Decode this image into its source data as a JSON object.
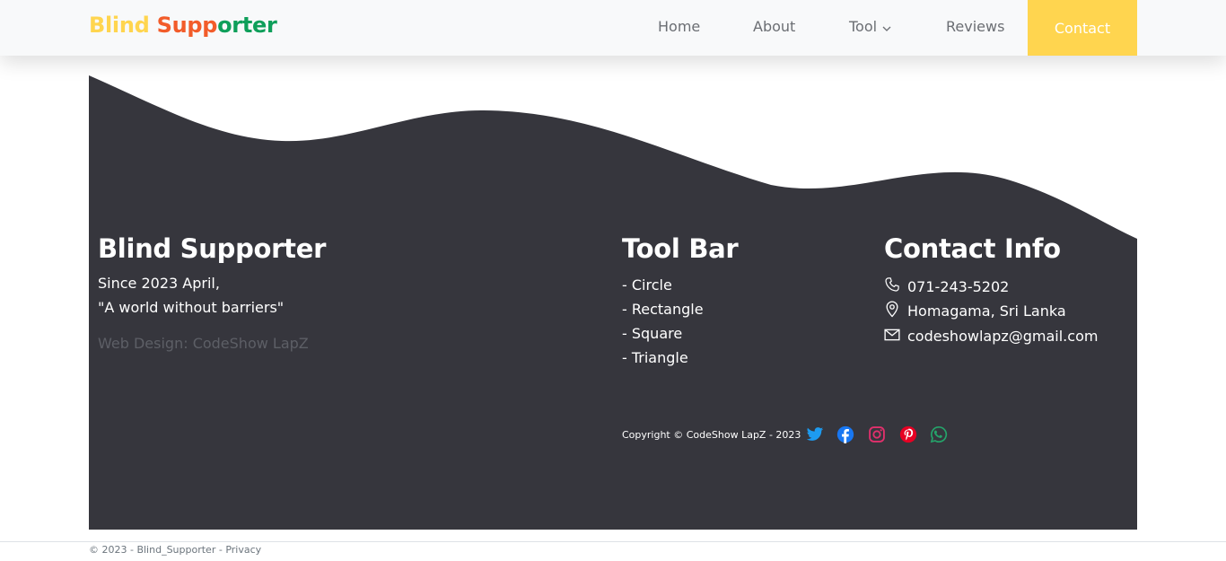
{
  "navbar": {
    "brand": {
      "part1": "Blind",
      "part2": "Supp",
      "part3": "orter"
    },
    "links": [
      {
        "label": "Home"
      },
      {
        "label": "About"
      },
      {
        "label": "Tool"
      },
      {
        "label": "Reviews"
      },
      {
        "label": "Contact"
      }
    ],
    "tool_dropdown_icon": "chevron-down-icon"
  },
  "footer": {
    "about": {
      "title": "Blind Supporter",
      "line1": "Since 2023 April,",
      "line2": "\"A world without barriers\"",
      "credit": "Web Design: CodeShow LapZ"
    },
    "toolbar": {
      "title": "Tool Bar",
      "items": [
        "- Circle",
        "- Rectangle",
        "- Square",
        "- Triangle"
      ]
    },
    "contact": {
      "title": "Contact Info",
      "phone": "071-243-5202",
      "location": "Homagama, Sri Lanka",
      "email": "codeshowlapz@gmail.com"
    },
    "copyright": "Copyright © CodeShow LapZ - 2023",
    "socials": [
      {
        "name": "twitter-icon",
        "color": "#1d9bf0"
      },
      {
        "name": "facebook-icon",
        "color": "#1877f2"
      },
      {
        "name": "instagram-icon",
        "color": "#e1306c"
      },
      {
        "name": "pinterest-icon",
        "color": "#e60023"
      },
      {
        "name": "whatsapp-icon",
        "color": "#25a36a"
      }
    ]
  },
  "bottom": {
    "text": "© 2023 - Blind_Supporter - ",
    "privacy": "Privacy"
  },
  "colors": {
    "brand_yellow": "#ffd54f",
    "brand_orange": "#f25c2a",
    "brand_green": "#0e9f5a",
    "footer_bg": "#36363d",
    "nav_bg": "#f8f9fa"
  }
}
